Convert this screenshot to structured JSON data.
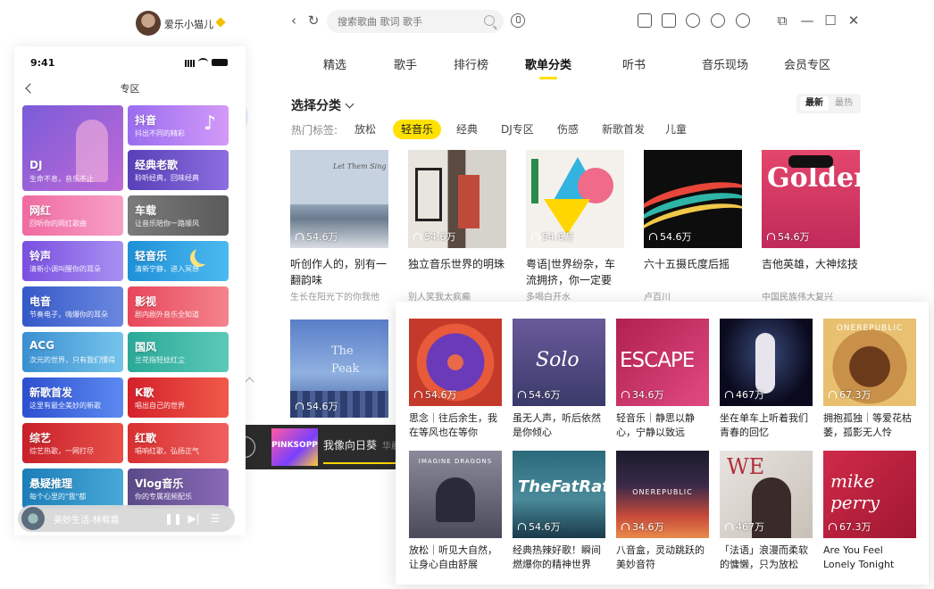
{
  "desktop": {
    "search_placeholder": "搜索歌曲 歌词 歌手",
    "tabs": [
      "精选",
      "歌手",
      "排行榜",
      "歌单分类",
      "听书",
      "音乐现场",
      "会员专区"
    ],
    "active_tab": "歌单分类",
    "section_title": "选择分类",
    "sort_options": [
      "最新",
      "最热"
    ],
    "hot_label": "热门标签:",
    "tags": [
      "放松",
      "轻音乐",
      "经典",
      "DJ专区",
      "伤感",
      "新歌首发",
      "儿童"
    ],
    "active_tag": "轻音乐",
    "cards": [
      {
        "plays": "54.6万",
        "title": "听创作人的，别有一翻韵味",
        "sub": "生长在阳光下的你我他",
        "cover_text": "Let Them Sing"
      },
      {
        "plays": "54.6万",
        "title": "独立音乐世界的明珠",
        "sub": "别人笑我太疯癫",
        "cover_text": ""
      },
      {
        "plays": "54.6万",
        "title": "粤语|世界纷杂，车流拥挤，你一定要找...",
        "sub": "多喝白开水",
        "cover_text": ""
      },
      {
        "plays": "54.6万",
        "title": "六十五摄氏度后摇",
        "sub": "卢百川",
        "cover_text": ""
      },
      {
        "plays": "54.6万",
        "title": "吉他英雄，大神炫技",
        "sub": "中国民族伟大复兴",
        "cover_text": "Golden"
      },
      {
        "plays": "54.6万",
        "title": "",
        "sub": "",
        "cover_text": "The Peak"
      }
    ],
    "player": {
      "title": "我像向日葵",
      "artist": "华晨",
      "thumb_text": "PINKSOPP"
    }
  },
  "profile": {
    "username": "爱乐小猫儿"
  },
  "phone": {
    "time": "9:41",
    "title": "专区",
    "tiles": [
      {
        "name": "DJ",
        "desc": "生命不息，音乐不止"
      },
      {
        "name": "抖音",
        "desc": "抖出不同的精彩"
      },
      {
        "name": "经典老歌",
        "desc": "聆听经典，回味经典"
      },
      {
        "name": "网红",
        "desc": "回听你的网红歌曲"
      },
      {
        "name": "车载",
        "desc": "让音乐陪你一路顺风"
      },
      {
        "name": "铃声",
        "desc": "清新小调叫醒你的耳朵"
      },
      {
        "name": "轻音乐",
        "desc": "清新宁静，进入冥想"
      },
      {
        "name": "电音",
        "desc": "节奏电子，嗨爆你的耳朵"
      },
      {
        "name": "影视",
        "desc": "剧内剧外音乐全知道"
      },
      {
        "name": "ACG",
        "desc": "次元的世界，只有我们懂得"
      },
      {
        "name": "国风",
        "desc": "兰花指轻捻红尘"
      },
      {
        "name": "新歌首发",
        "desc": "这里有最全美妙的新歌"
      },
      {
        "name": "K歌",
        "desc": "唱出自己的世界"
      },
      {
        "name": "综艺",
        "desc": "综艺热歌，一网打尽"
      },
      {
        "name": "红歌",
        "desc": "唱响红歌，弘扬正气"
      },
      {
        "name": "悬疑推理",
        "desc": "每个心里的\"我\"都"
      },
      {
        "name": "Vlog音乐",
        "desc": "你的专属视频配乐"
      }
    ],
    "mini_player": {
      "title": "美妙生活-林宥嘉"
    }
  },
  "panel": {
    "cards": [
      {
        "plays": "54.6万",
        "title": "思念｜往后余生，我在等风也在等你",
        "cover_text": ""
      },
      {
        "plays": "54.6万",
        "title": "虽无人声，听后依然是你倾心",
        "cover_text": "Solo"
      },
      {
        "plays": "34.6万",
        "title": "轻音乐｜静思以静心，宁静以致远",
        "cover_text": "ESCAPE"
      },
      {
        "plays": "467万",
        "title": "坐在单车上听着我们青春的回忆",
        "cover_text": ""
      },
      {
        "plays": "67.3万",
        "title": "拥抱孤独｜等爱花枯萎，孤影无人怜",
        "cover_text": "ONEREPUBLIC"
      },
      {
        "plays": "",
        "title": "放松｜听见大自然，让身心自由舒展",
        "cover_text": "IMAGINE DRAGONS"
      },
      {
        "plays": "54.6万",
        "title": "经典热辣好歌！瞬间燃爆你的精神世界",
        "cover_text": "TheFatRat"
      },
      {
        "plays": "34.6万",
        "title": "八音盒，灵动跳跃的美妙音符",
        "cover_text": "ONEREPUBLIC"
      },
      {
        "plays": "467万",
        "title": "「法语」浪漫而柔软的慵懒，只为放松",
        "cover_text": "WE"
      },
      {
        "plays": "67.3万",
        "title": "Are You Feel Lonely Tonight",
        "cover_text": "mike perry"
      }
    ]
  },
  "colors": {
    "accent": "#ffe100",
    "text": "#222222",
    "muted": "#999999"
  }
}
